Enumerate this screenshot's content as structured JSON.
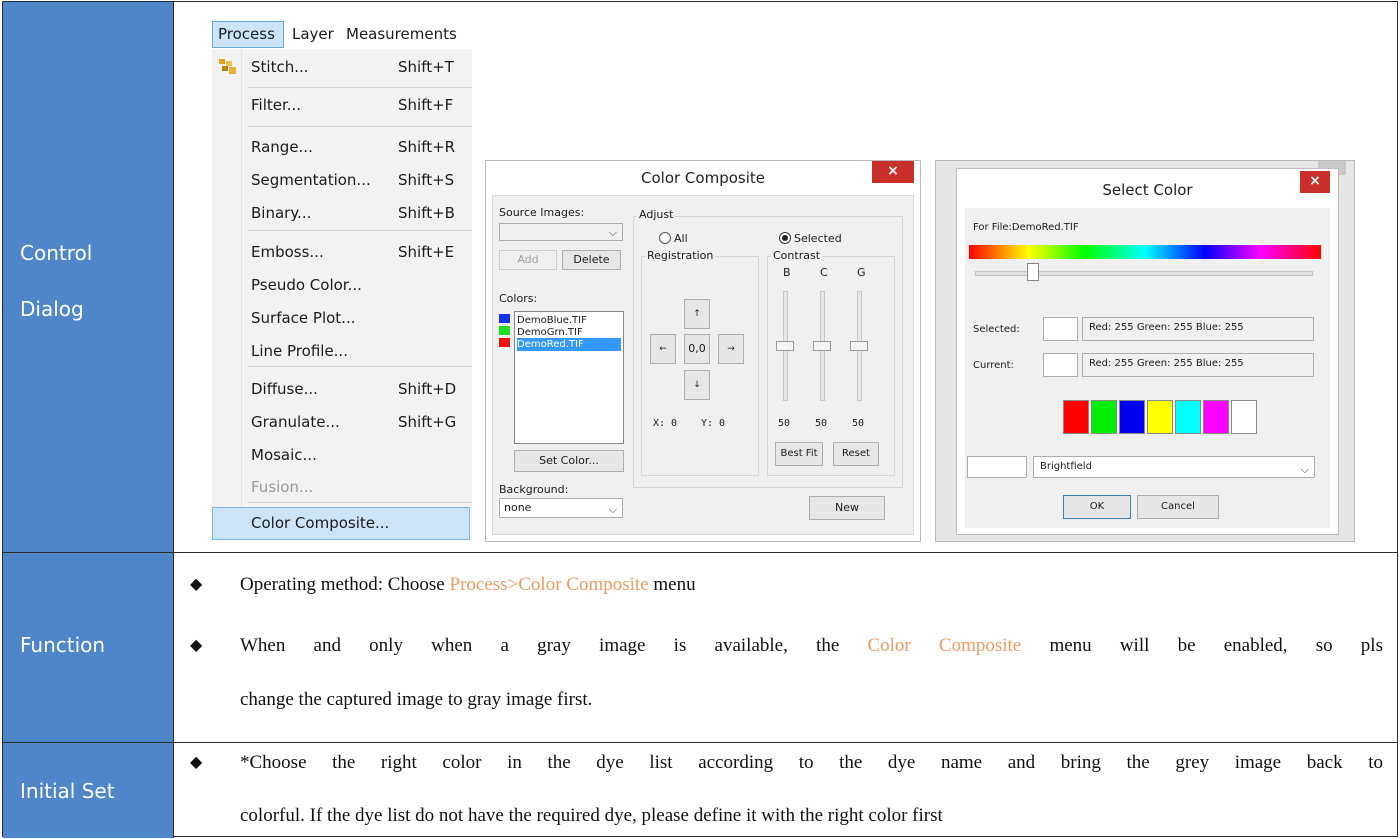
{
  "rows": {
    "control_dialog": {
      "label_line1": "Control",
      "label_line2": "Dialog"
    },
    "function": {
      "label": "Function",
      "bullet1_prefix": "Operating method: Choose ",
      "bullet1_highlight": "Process>Color Composite",
      "bullet1_suffix": " menu",
      "bullet2_prefix": "When and only when a gray image is available, the ",
      "bullet2_highlight": "Color Composite",
      "bullet2_suffix": " menu will be enabled, so pls",
      "bullet2_line2": "change the captured image to gray image first."
    },
    "initial_set": {
      "label": "Initial Set",
      "line1": "*Choose the right color in the dye list according to the dye name and bring the grey image back to",
      "line2": "colorful. If the dye list do not have the required dye, please define it with the right color first"
    }
  },
  "menu": {
    "bar": [
      "Process",
      "Layer",
      "Measurements"
    ],
    "items": [
      {
        "label": "Stitch...",
        "shortcut": "Shift+T"
      },
      {
        "label": "Filter...",
        "shortcut": "Shift+F"
      },
      {
        "label": "Range...",
        "shortcut": "Shift+R"
      },
      {
        "label": "Segmentation...",
        "shortcut": "Shift+S"
      },
      {
        "label": "Binary...",
        "shortcut": "Shift+B"
      },
      {
        "label": "Emboss...",
        "shortcut": "Shift+E"
      },
      {
        "label": "Pseudo Color...",
        "shortcut": ""
      },
      {
        "label": "Surface Plot...",
        "shortcut": ""
      },
      {
        "label": "Line Profile...",
        "shortcut": ""
      },
      {
        "label": "Diffuse...",
        "shortcut": "Shift+D"
      },
      {
        "label": "Granulate...",
        "shortcut": "Shift+G"
      },
      {
        "label": "Mosaic...",
        "shortcut": ""
      },
      {
        "label": "Fusion...",
        "shortcut": ""
      },
      {
        "label": "Color Composite...",
        "shortcut": ""
      }
    ]
  },
  "composite_dialog": {
    "title": "Color Composite",
    "close": "×",
    "source_images_label": "Source Images:",
    "add": "Add",
    "delete": "Delete",
    "colors_label": "Colors:",
    "files": [
      "DemoBlue.TIF",
      "DemoGrn.TIF",
      "DemoRed.TIF"
    ],
    "file_colors": [
      "#1133ee",
      "#22dd22",
      "#ee1111"
    ],
    "set_color": "Set Color...",
    "background_label": "Background:",
    "background_value": "none",
    "adjust_label": "Adjust",
    "all_label": "All",
    "selected_label": "Selected",
    "registration_label": "Registration",
    "contrast_label": "Contrast",
    "reg_up": "↑",
    "reg_down": "↓",
    "reg_left": "←",
    "reg_right": "→",
    "reg_center": "0,0",
    "x_label": "X:  0",
    "y_label": "Y:  0",
    "channels": [
      "B",
      "C",
      "G"
    ],
    "channel_values": [
      "50",
      "50",
      "50"
    ],
    "best_fit": "Best Fit",
    "reset": "Reset",
    "new": "New"
  },
  "select_dialog": {
    "title": "Select Color",
    "close": "×",
    "for_file": "For File:DemoRed.TIF",
    "selected_label": "Selected:",
    "selected_value": "Red: 255 Green: 255 Blue: 255",
    "current_label": "Current:",
    "current_value": "Red: 255 Green: 255 Blue: 255",
    "palette": [
      "#ff0000",
      "#00ee00",
      "#0000ee",
      "#ffff00",
      "#00ffff",
      "#ff00ff",
      "#ffffff"
    ],
    "dye_value": "Brightfield",
    "ok": "OK",
    "cancel": "Cancel"
  }
}
